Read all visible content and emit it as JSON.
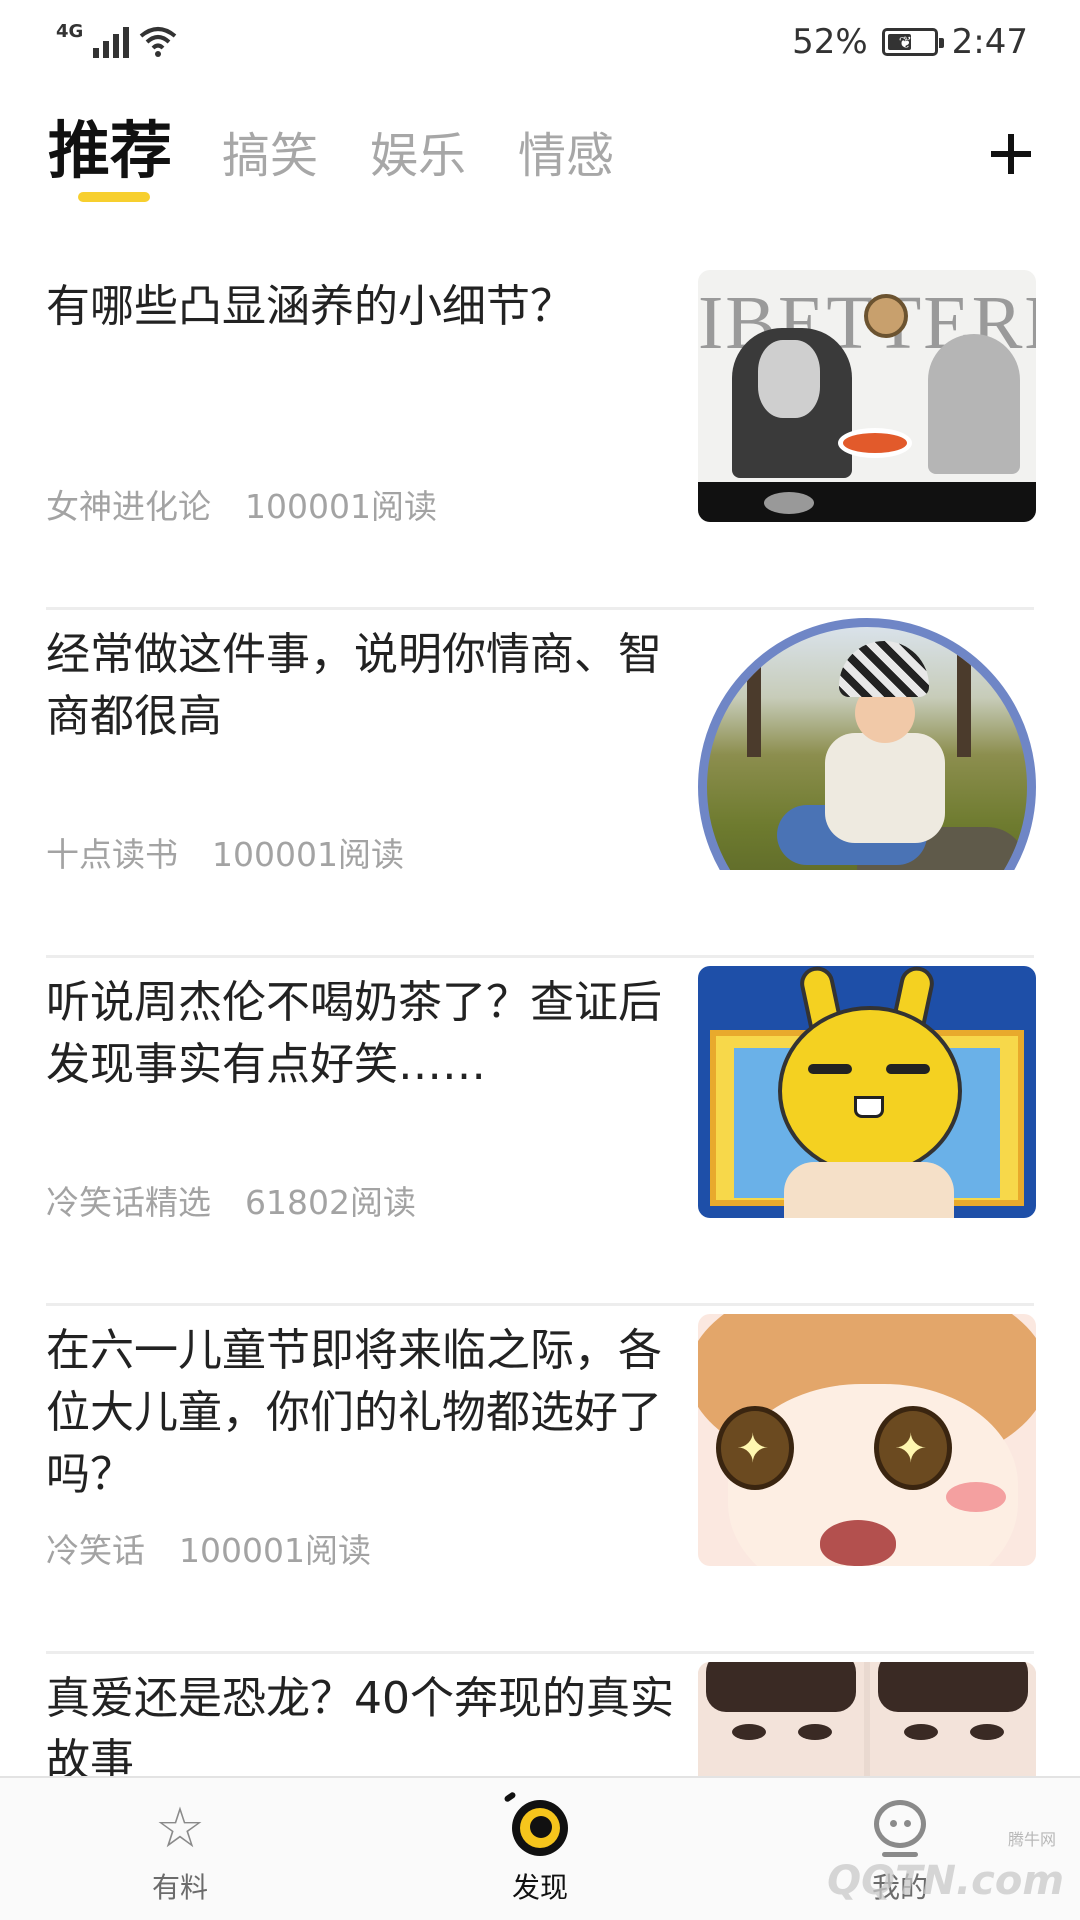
{
  "status_bar": {
    "network": "4G",
    "battery": "52%",
    "battery_level": 0.52,
    "time": "2:47"
  },
  "tabs": [
    {
      "label": "推荐",
      "active": true
    },
    {
      "label": "搞笑",
      "active": false
    },
    {
      "label": "娱乐",
      "active": false
    },
    {
      "label": "情感",
      "active": false
    }
  ],
  "add_button_icon": "plus-icon",
  "accent_color": "#f7cf2e",
  "feed": [
    {
      "title": "有哪些凸显涵养的小细节？",
      "source": "女神进化论",
      "reads": "100001阅读",
      "thumb_text": "IBETTERM"
    },
    {
      "title": "经常做这件事，说明你情商、智商都很高",
      "source": "十点读书",
      "reads": "100001阅读"
    },
    {
      "title": "听说周杰伦不喝奶茶了？查证后发现事实有点好笑……",
      "source": "冷笑话精选",
      "reads": "61802阅读"
    },
    {
      "title": "在六一儿童节即将来临之际，各位大儿童，你们的礼物都选好了吗？",
      "source": "冷笑话",
      "reads": "100001阅读"
    },
    {
      "title": "真爱还是恐龙？40个奔现的真实故事",
      "source": "",
      "reads": ""
    }
  ],
  "bottom_nav": [
    {
      "label": "有料",
      "icon": "star-icon",
      "active": false
    },
    {
      "label": "发现",
      "icon": "eye-icon",
      "active": true
    },
    {
      "label": "我的",
      "icon": "face-icon",
      "active": false
    }
  ],
  "watermark": {
    "main": "QQTN.com",
    "small": "腾牛网"
  }
}
